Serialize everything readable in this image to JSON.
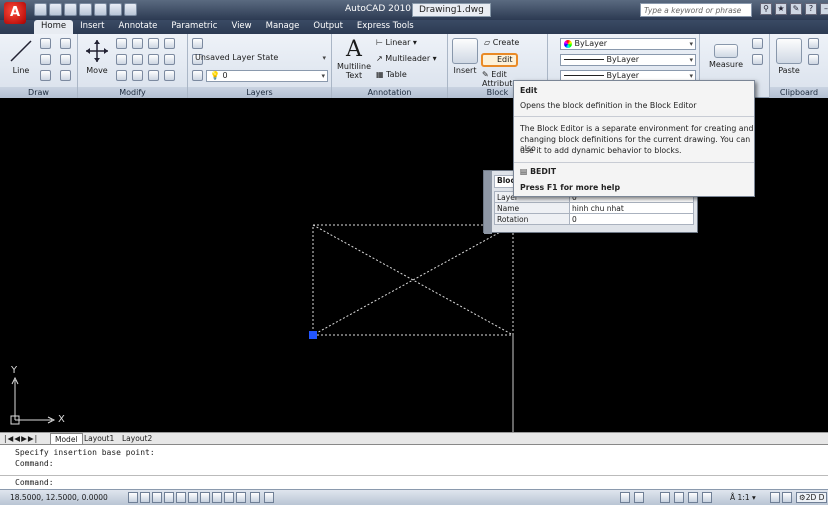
{
  "app": {
    "title": "AutoCAD 2010",
    "document": "Drawing1.dwg",
    "logo_letter": "A"
  },
  "search": {
    "placeholder": "Type a keyword or phrase"
  },
  "tabs": [
    "Home",
    "Insert",
    "Annotate",
    "Parametric",
    "View",
    "Manage",
    "Output",
    "Express Tools"
  ],
  "ribbon": {
    "draw": {
      "label": "Draw",
      "line": "Line"
    },
    "modify": {
      "label": "Modify",
      "move": "Move"
    },
    "layers": {
      "label": "Layers",
      "state": "Unsaved Layer State",
      "layer_value": "0"
    },
    "annotation": {
      "label": "Annotation",
      "multiline_text": "Multiline Text",
      "linear": "Linear",
      "multileader": "Multileader",
      "table": "Table"
    },
    "block": {
      "label": "Block",
      "insert": "Insert",
      "create": "Create",
      "edit": "Edit",
      "edit_attributes": "Edit Attributes"
    },
    "properties": {
      "color": "ByLayer",
      "linetype": "ByLayer",
      "lineweight": "ByLayer"
    },
    "utilities": {
      "measure": "Measure"
    },
    "clipboard": {
      "label": "Clipboard",
      "paste": "Paste"
    }
  },
  "tooltip": {
    "title": "Edit",
    "description": "Opens the block definition in the Block Editor",
    "detail_line1": "The Block Editor is a separate environment for creating and",
    "detail_line2": "changing block definitions for the current drawing. You can also",
    "detail_line3": "use it to add dynamic behavior to blocks.",
    "command": "BEDIT",
    "help": "Press F1 for more help"
  },
  "properties_palette": {
    "header": "Block",
    "rows": [
      {
        "key": "Layer",
        "value": "0"
      },
      {
        "key": "Name",
        "value": "hinh chu nhat"
      },
      {
        "key": "Rotation",
        "value": "0"
      }
    ]
  },
  "axes": {
    "y": "Y",
    "x": "X"
  },
  "layout_tabs": [
    "Model",
    "Layout1",
    "Layout2"
  ],
  "command": {
    "line1": "Specify insertion base point:",
    "line2": "Command:",
    "prompt": "Command:"
  },
  "status": {
    "coords": "18.5000, 12.5000, 0.0000",
    "scale": "1:1",
    "workspace": "2D D"
  },
  "colors": {
    "canvas": "#000000",
    "highlight": "#e98a27",
    "grip": "#2255ff"
  }
}
